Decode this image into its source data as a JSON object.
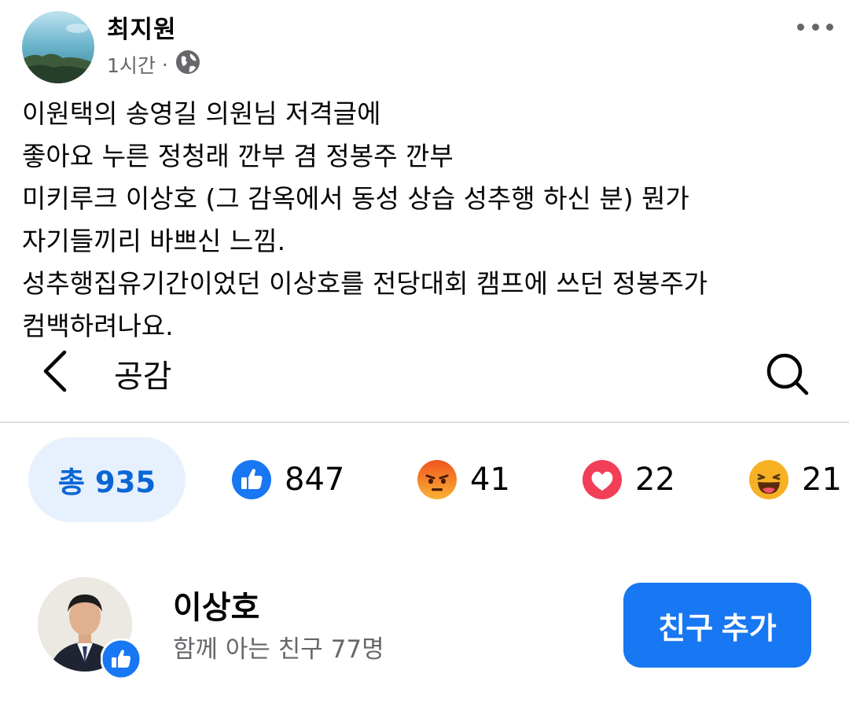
{
  "post": {
    "author": "최지원",
    "time": "1시간",
    "separator": "·",
    "lines": [
      "이원택의 송영길 의원님 저격글에",
      "좋아요 누른 정청래 깐부 겸 정봉주 깐부",
      "미키루크 이상호 (그 감옥에서 동성 상습 성추행 하신 분) 뭔가",
      "자기들끼리 바쁘신 느낌.",
      "성추행집유기간이었던 이상호를 전당대회 캠프에 쓰던 정봉주가",
      "컴백하려나요."
    ]
  },
  "reactions": {
    "title": "공감",
    "total_label": "총 935",
    "tabs": [
      {
        "icon": "like-icon",
        "count": "847",
        "color": "#1877f2"
      },
      {
        "icon": "angry-icon",
        "count": "41",
        "color": "#e9710f"
      },
      {
        "icon": "love-icon",
        "count": "22",
        "color": "#f33e58"
      },
      {
        "icon": "haha-icon",
        "count": "21",
        "color": "#f7b125"
      }
    ]
  },
  "person": {
    "name": "이상호",
    "mutual_friends": "함께 아는 친구 77명",
    "add_friend_label": "친구 추가"
  },
  "colors": {
    "accent": "#1877f2",
    "total_tab_bg": "#e7f0fd",
    "total_tab_text": "#0a66d4",
    "secondary_text": "#65676b"
  }
}
